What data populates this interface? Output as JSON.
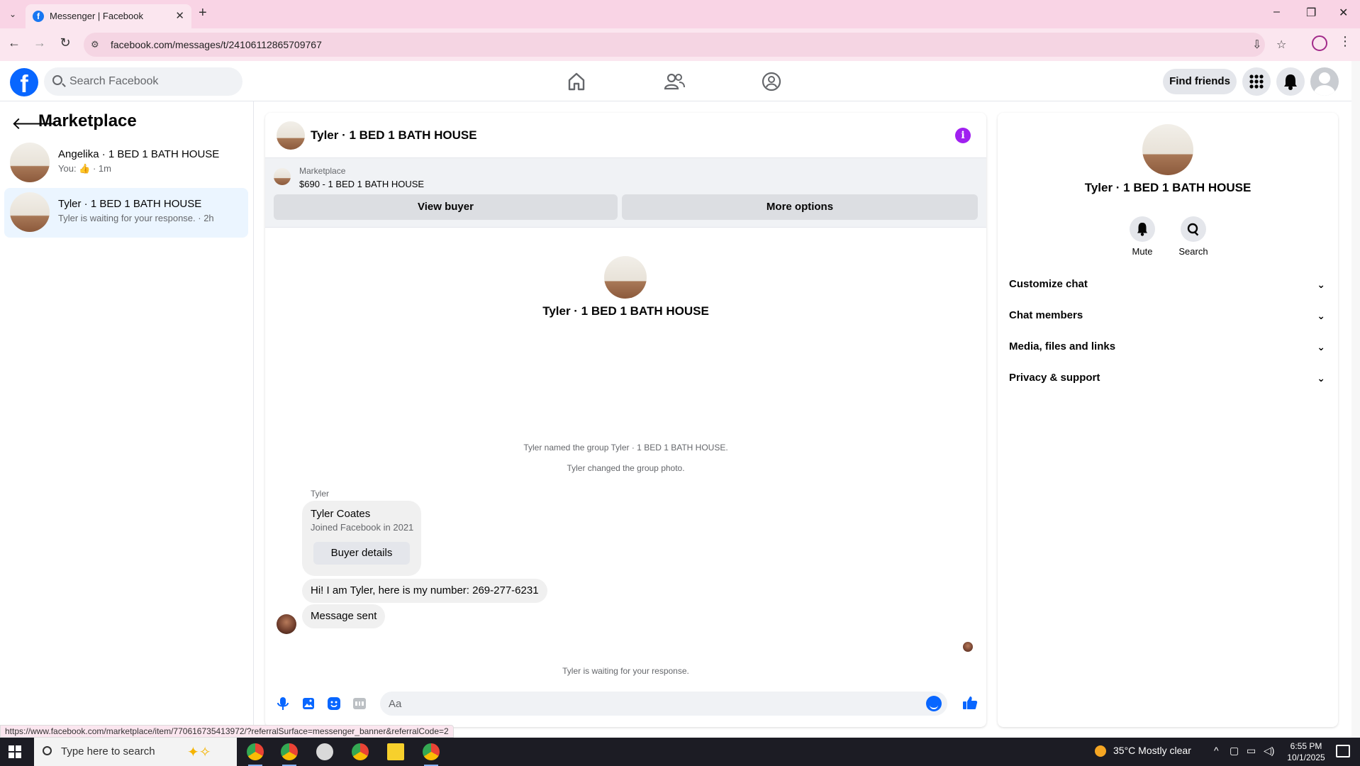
{
  "browser": {
    "tab_title": "Messenger | Facebook",
    "url": "facebook.com/messages/t/24106112865709767",
    "status_url": "https://www.facebook.com/marketplace/item/770616735413972/?referralSurface=messenger_banner&referralCode=2"
  },
  "fb_header": {
    "search_placeholder": "Search Facebook",
    "find_friends": "Find friends"
  },
  "left_pane": {
    "title": "Marketplace",
    "conversations": [
      {
        "name": "Angelika · 1 BED 1 BATH HOUSE",
        "sub": "You: 👍 · 1m",
        "active": false
      },
      {
        "name": "Tyler · 1 BED 1 BATH HOUSE",
        "sub": "Tyler is waiting for your response. · 2h",
        "active": true
      }
    ]
  },
  "chat": {
    "title": "Tyler · 1 BED 1 BATH HOUSE",
    "banner": {
      "label": "Marketplace",
      "listing": "$690 - 1 BED 1 BATH HOUSE",
      "view_buyer": "View buyer",
      "more_options": "More options"
    },
    "center_name": "Tyler · 1 BED 1 BATH HOUSE",
    "system_messages": [
      "Tyler named the group Tyler · 1 BED 1 BATH HOUSE.",
      "Tyler changed the group photo."
    ],
    "sender_label": "Tyler",
    "buyer_card": {
      "name": "Tyler Coates",
      "joined": "Joined Facebook in 2021",
      "button": "Buyer details"
    },
    "messages": [
      "Hi! I am Tyler, here is my number: 269-277-6231",
      "Message sent"
    ],
    "waiting_text": "Tyler is waiting for your response.",
    "composer_placeholder": "Aa"
  },
  "right_pane": {
    "name": "Tyler · 1 BED 1 BATH HOUSE",
    "actions": {
      "mute": "Mute",
      "search": "Search"
    },
    "sections": [
      "Customize chat",
      "Chat members",
      "Media, files and links",
      "Privacy & support"
    ]
  },
  "taskbar": {
    "search_placeholder": "Type here to search",
    "weather": "35°C  Mostly clear",
    "time": "6:55 PM",
    "date": "10/1/2025"
  },
  "colors": {
    "fb_blue": "#0866ff",
    "active_conv": "#ebf5ff",
    "info_purple": "#a020f0",
    "chrome_pink": "#f9d4e5"
  }
}
